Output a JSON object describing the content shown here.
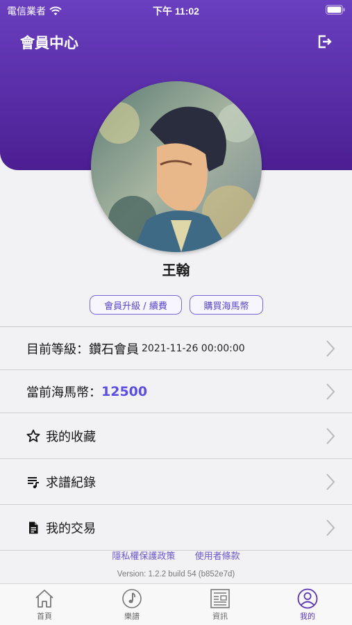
{
  "status_bar": {
    "carrier": "電信業者",
    "time": "下午 11:02"
  },
  "header": {
    "title": "會員中心",
    "logout_icon": "logout-icon"
  },
  "profile": {
    "name": "王翰"
  },
  "actions": {
    "upgrade_label": "會員升級 / 續費",
    "buy_label": "購買海馬幣"
  },
  "menu": {
    "level_label": "目前等級：鑽石會員",
    "level_date": "2021-11-26 00:00:00",
    "coins_label": "當前海馬幣：",
    "coins_value": "12500",
    "favorites_label": "我的收藏",
    "requests_label": "求譜紀錄",
    "transactions_label": "我的交易"
  },
  "footer": {
    "privacy_label": "隱私權保護政策",
    "terms_label": "使用者條款",
    "version": "Version: 1.2.2 build 54 (b852e7d)"
  },
  "tabs": [
    {
      "label": "首頁",
      "icon": "home-icon"
    },
    {
      "label": "樂譜",
      "icon": "music-note-icon"
    },
    {
      "label": "資訊",
      "icon": "news-icon"
    },
    {
      "label": "我的",
      "icon": "user-icon",
      "active": true
    }
  ],
  "colors": {
    "header": "#4b1f92",
    "accent": "#5a4fe0"
  }
}
